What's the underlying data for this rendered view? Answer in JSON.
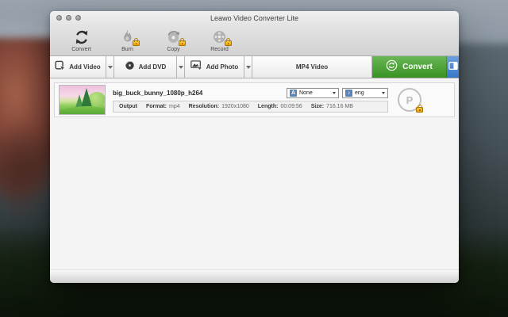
{
  "window": {
    "title": "Leawo Video Converter Lite"
  },
  "toolbar": {
    "items": [
      {
        "label": "Convert",
        "icon": "sync-arrows",
        "locked": false
      },
      {
        "label": "Burn",
        "icon": "flame-disc",
        "locked": true
      },
      {
        "label": "Copy",
        "icon": "disc-copy",
        "locked": true
      },
      {
        "label": "Record",
        "icon": "disc-record",
        "locked": true
      }
    ]
  },
  "action_bar": {
    "add_video": "Add Video",
    "add_dvd": "Add DVD",
    "add_photo": "Add Photo",
    "output_profile": "MP4 Video",
    "convert": "Convert"
  },
  "file_list": {
    "items": [
      {
        "name": "big_buck_bunny_1080p_h264",
        "output_label": "Output",
        "format_label": "Format:",
        "format": "mp4",
        "resolution_label": "Resolution:",
        "resolution": "1920x1080",
        "length_label": "Length:",
        "length": "00:09:56",
        "size_label": "Size:",
        "size": "716.16 MB",
        "subtitle": "None",
        "audio": "eng"
      }
    ]
  },
  "icons": {
    "subtitle_glyph": "A",
    "audio_glyph": "♪",
    "edit_glyph": "P"
  },
  "colors": {
    "convert_green": "#3fa226",
    "panel_blue": "#3b82d8",
    "lock_gold": "#e89e06",
    "subtitle_icon_blue": "#5b83b5"
  }
}
